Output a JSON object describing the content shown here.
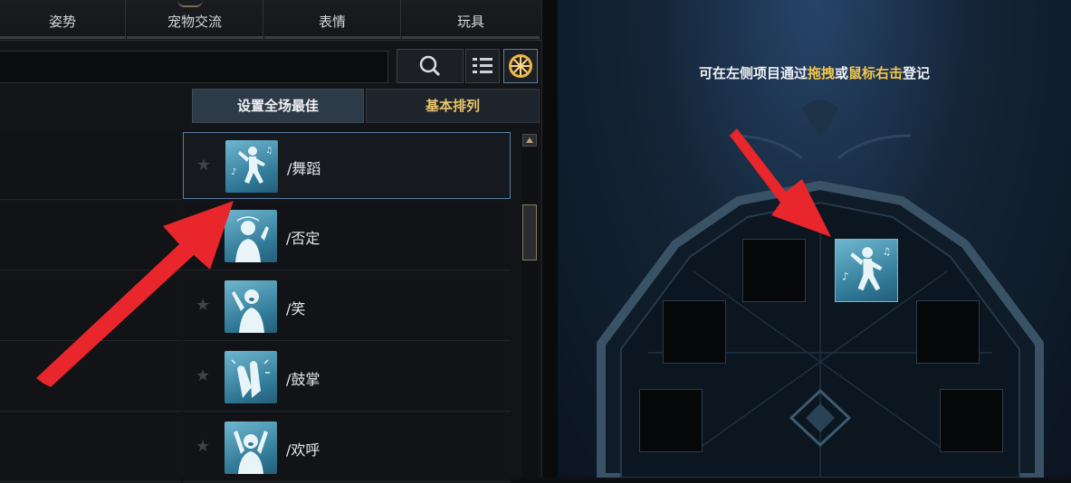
{
  "tabs": [
    {
      "label": "姿势"
    },
    {
      "label": "宠物交流"
    },
    {
      "label": "表情"
    },
    {
      "label": "玩具"
    }
  ],
  "toolbar": {
    "search_icon": "search-icon",
    "list_icon": "list-view-icon",
    "wheel_icon": "wheel-view-icon"
  },
  "sort_buttons": {
    "set_best": "设置全场最佳",
    "basic_sort": "基本排列"
  },
  "emotes": [
    {
      "label": "/舞蹈",
      "icon": "dance-icon",
      "selected": true
    },
    {
      "label": "/否定",
      "icon": "deny-icon",
      "selected": false
    },
    {
      "label": "/笑",
      "icon": "laugh-icon",
      "selected": false
    },
    {
      "label": "/鼓掌",
      "icon": "clap-icon",
      "selected": false
    },
    {
      "label": "/欢呼",
      "icon": "cheer-icon",
      "selected": false
    }
  ],
  "hint": {
    "part1": "可在左侧项目通过",
    "drag": "拖拽",
    "or": "或",
    "right_click": "鼠标右击",
    "part2": "登记"
  },
  "colors": {
    "highlight": "#f3c64a",
    "arrow": "#e8262b",
    "selection_border": "#5a7fa3"
  }
}
